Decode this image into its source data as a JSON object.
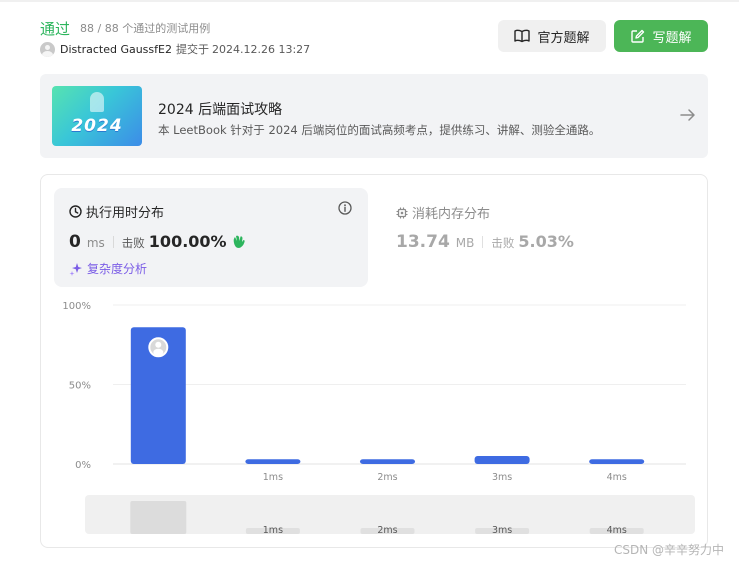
{
  "header": {
    "status": "通过",
    "tests_passed": "88 / 88 个通过的测试用例",
    "author": "Distracted GaussfE2",
    "submit_text": "提交于",
    "submit_time": "2024.12.26 13:27",
    "official_solution_label": "官方题解",
    "write_solution_label": "写题解"
  },
  "banner": {
    "image_text": "2024",
    "title": "2024 后端面试攻略",
    "description": "本 LeetBook 针对于 2024 后端岗位的面试高频考点，提供练习、讲解、测验全通路。"
  },
  "runtime_tab": {
    "title": "执行用时分布",
    "value": "0",
    "unit": "ms",
    "beat_label": "击败",
    "beat_value": "100.00%",
    "analysis_label": "复杂度分析"
  },
  "memory_tab": {
    "title": "消耗内存分布",
    "value": "13.74",
    "unit": "MB",
    "beat_label": "击败",
    "beat_value": "5.03%"
  },
  "chart_data": {
    "type": "bar",
    "categories": [
      "0ms",
      "1ms",
      "2ms",
      "3ms",
      "4ms"
    ],
    "category_labels_shown": [
      "",
      "1ms",
      "2ms",
      "3ms",
      "4ms"
    ],
    "values": [
      86,
      3,
      3,
      5,
      3
    ],
    "ylim": [
      0,
      100
    ],
    "yticks": [
      "100%",
      "50%",
      "0%"
    ],
    "ytick_values": [
      100,
      50,
      0
    ],
    "highlighted_index": 0,
    "grid": true,
    "bar_color": "#3e6be2",
    "navigator": {
      "labels": [
        "1ms",
        "2ms",
        "3ms",
        "4ms"
      ]
    }
  },
  "colors": {
    "accent_green": "#2db55d",
    "button_green": "#4cb657",
    "bar_blue": "#3e6be2",
    "analysis_purple": "#7b5de6"
  },
  "watermark": "CSDN @辛辛努力中"
}
